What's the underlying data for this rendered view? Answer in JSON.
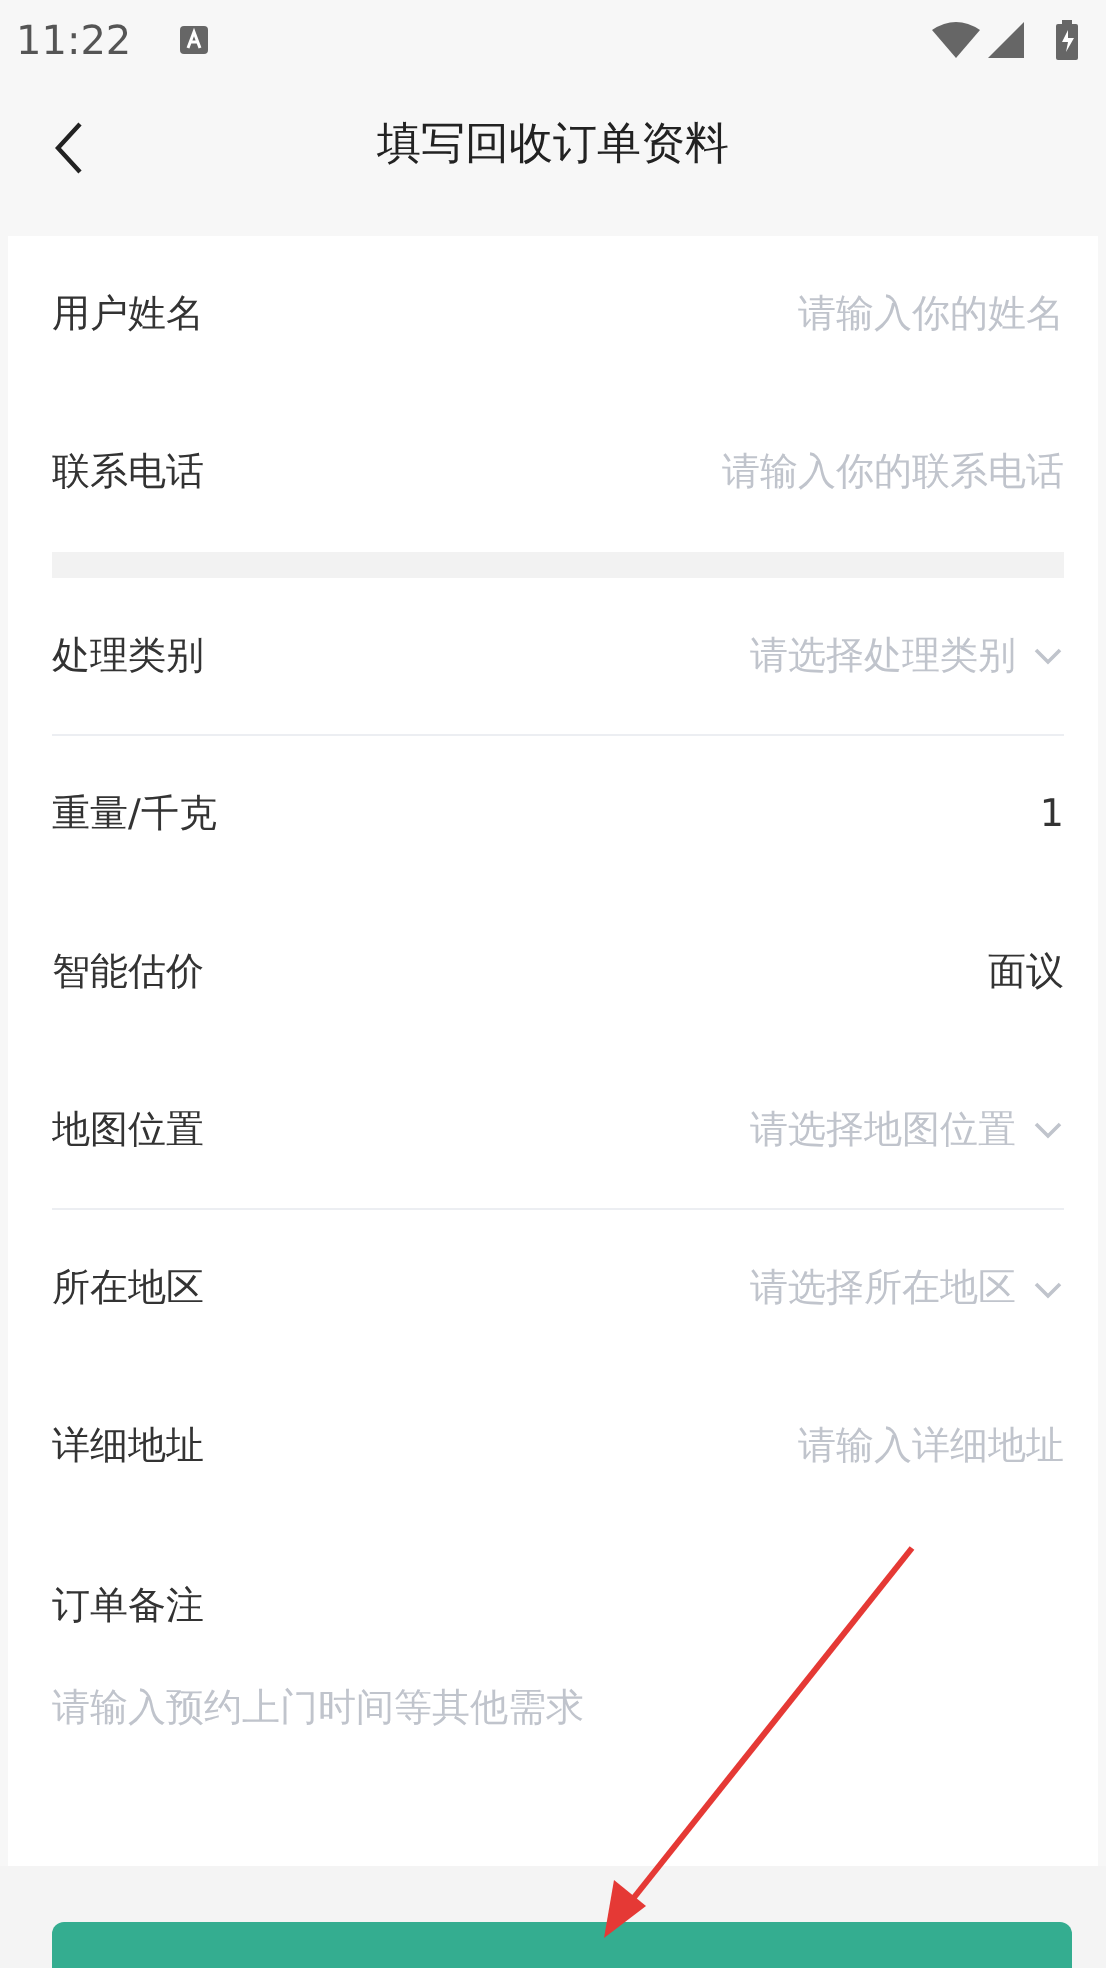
{
  "status_bar": {
    "time": "11:22"
  },
  "header": {
    "title": "填写回收订单资料"
  },
  "groups": [
    {
      "rows": [
        {
          "kind": "input",
          "label": "用户姓名",
          "placeholder": "请输入你的姓名",
          "divider_below": false
        },
        {
          "kind": "input",
          "label": "联系电话",
          "placeholder": "请输入你的联系电话",
          "divider_below": false
        }
      ]
    },
    {
      "rows": [
        {
          "kind": "select",
          "label": "处理类别",
          "placeholder": "请选择处理类别",
          "divider_below": true
        },
        {
          "kind": "text",
          "label": "重量/千克",
          "value": "1",
          "divider_below": false
        },
        {
          "kind": "text",
          "label": "智能估价",
          "value": "面议",
          "divider_below": false
        },
        {
          "kind": "select",
          "label": "地图位置",
          "placeholder": "请选择地图位置",
          "divider_below": true
        },
        {
          "kind": "select",
          "label": "所在地区",
          "placeholder": "请选择所在地区",
          "divider_below": false
        },
        {
          "kind": "input",
          "label": "详细地址",
          "placeholder": "请输入详细地址",
          "divider_below": false
        }
      ]
    }
  ],
  "remark": {
    "label": "订单备注",
    "placeholder": "请输入预约上门时间等其他需求"
  },
  "submit_button": {
    "kind": "button"
  }
}
